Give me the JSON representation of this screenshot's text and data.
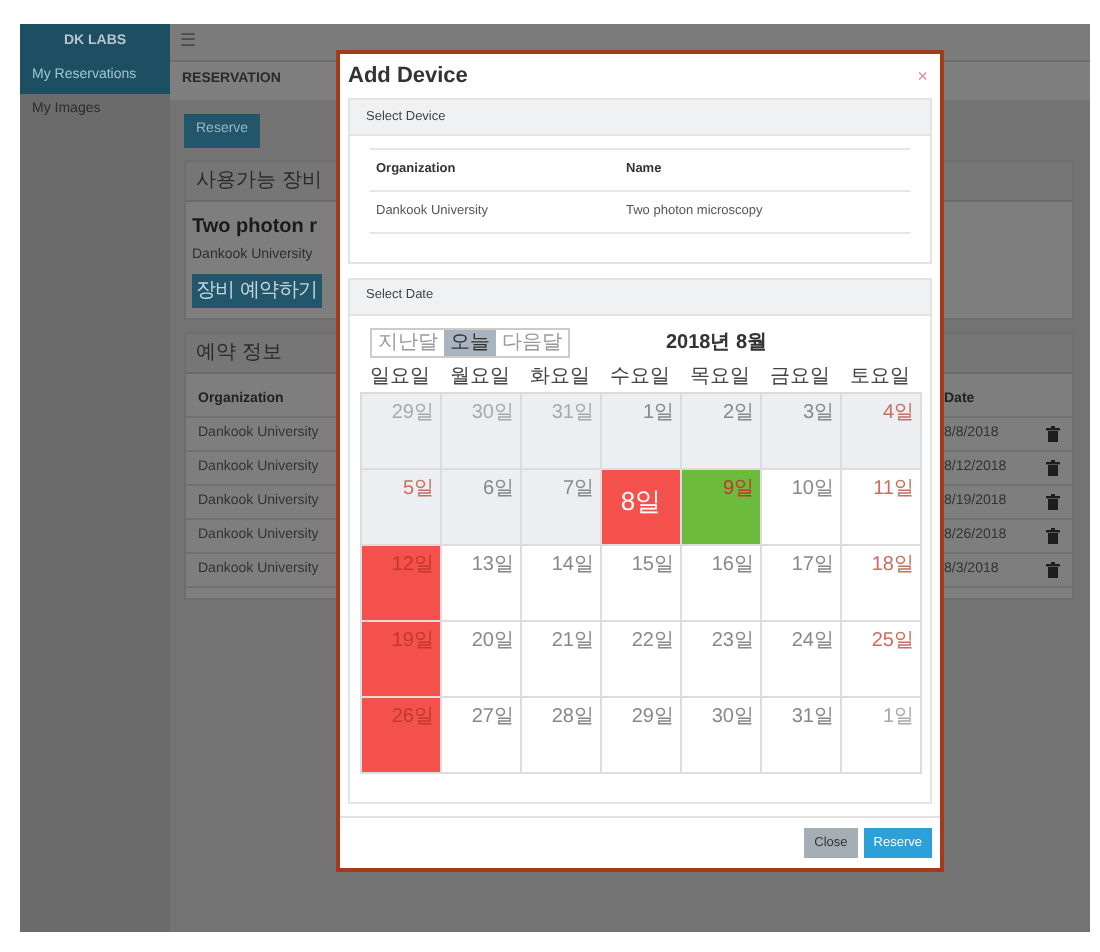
{
  "sidebar": {
    "brand": "DK LABS",
    "items": [
      {
        "label": "My Reservations",
        "selected": true
      },
      {
        "label": "My Images",
        "selected": false
      }
    ]
  },
  "topbar": {
    "menu": "☰",
    "breadcrumb": "RESERVATION"
  },
  "reserve_button": "Reserve",
  "available_card": {
    "title": "사용가능 장비",
    "device_name": "Two photon r",
    "organization": "Dankook University",
    "button": "장비 예약하기"
  },
  "reservations_card": {
    "title": "예약 정보",
    "columns": [
      "Organization",
      "Date"
    ],
    "rows": [
      {
        "organization": "Dankook University",
        "date": "8/8/2018"
      },
      {
        "organization": "Dankook University",
        "date": "8/12/2018"
      },
      {
        "organization": "Dankook University",
        "date": "8/19/2018"
      },
      {
        "organization": "Dankook University",
        "date": "8/26/2018"
      },
      {
        "organization": "Dankook University",
        "date": "8/3/2018"
      }
    ]
  },
  "modal": {
    "title": "Add Device",
    "close": "×",
    "device_section": {
      "title": "Select Device",
      "columns": [
        "Organization",
        "Name"
      ],
      "rows": [
        [
          "Dankook University",
          "Two photon microscopy"
        ]
      ]
    },
    "date_section": {
      "title": "Select Date",
      "nav": [
        {
          "label": "지난달",
          "selected": false
        },
        {
          "label": "오늘",
          "selected": true
        },
        {
          "label": "다음달",
          "selected": false
        }
      ],
      "month": "2018년 8월",
      "weekdays": [
        "일요일",
        "월요일",
        "화요일",
        "수요일",
        "목요일",
        "금요일",
        "토요일"
      ],
      "weeks": [
        [
          {
            "label": "29일",
            "past": true,
            "other_month": true
          },
          {
            "label": "30일",
            "past": true,
            "other_month": true
          },
          {
            "label": "31일",
            "past": true,
            "other_month": true
          },
          {
            "label": "1일",
            "past": true,
            "other_month": false
          },
          {
            "label": "2일",
            "past": true,
            "other_month": false
          },
          {
            "label": "3일",
            "past": true,
            "other_month": false
          },
          {
            "label": "4일",
            "past": true,
            "other_month": false
          }
        ],
        [
          {
            "label": "5일",
            "past": true,
            "other_month": false
          },
          {
            "label": "6일",
            "past": true,
            "other_month": false
          },
          {
            "label": "7일",
            "past": true,
            "other_month": false
          },
          {
            "label": "8일",
            "past": false,
            "other_month": false,
            "today": true,
            "color": "#f5514c"
          },
          {
            "label": "9일",
            "past": false,
            "other_month": false,
            "color": "#6cbb3c"
          },
          {
            "label": "10일",
            "past": false,
            "other_month": false
          },
          {
            "label": "11일",
            "past": false,
            "other_month": false
          }
        ],
        [
          {
            "label": "12일",
            "past": false,
            "other_month": false,
            "color": "#f5514c"
          },
          {
            "label": "13일",
            "past": false,
            "other_month": false
          },
          {
            "label": "14일",
            "past": false,
            "other_month": false
          },
          {
            "label": "15일",
            "past": false,
            "other_month": false
          },
          {
            "label": "16일",
            "past": false,
            "other_month": false
          },
          {
            "label": "17일",
            "past": false,
            "other_month": false
          },
          {
            "label": "18일",
            "past": false,
            "other_month": false
          }
        ],
        [
          {
            "label": "19일",
            "past": false,
            "other_month": false,
            "color": "#f5514c"
          },
          {
            "label": "20일",
            "past": false,
            "other_month": false
          },
          {
            "label": "21일",
            "past": false,
            "other_month": false
          },
          {
            "label": "22일",
            "past": false,
            "other_month": false
          },
          {
            "label": "23일",
            "past": false,
            "other_month": false
          },
          {
            "label": "24일",
            "past": false,
            "other_month": false
          },
          {
            "label": "25일",
            "past": false,
            "other_month": false
          }
        ],
        [
          {
            "label": "26일",
            "past": false,
            "other_month": false,
            "color": "#f5514c"
          },
          {
            "label": "27일",
            "past": false,
            "other_month": false
          },
          {
            "label": "28일",
            "past": false,
            "other_month": false
          },
          {
            "label": "29일",
            "past": false,
            "other_month": false
          },
          {
            "label": "30일",
            "past": false,
            "other_month": false
          },
          {
            "label": "31일",
            "past": false,
            "other_month": false
          },
          {
            "label": "1일",
            "past": false,
            "other_month": true
          }
        ]
      ]
    },
    "buttons": [
      {
        "label": "Close",
        "kind": "secondary"
      },
      {
        "label": "Reserve",
        "kind": "primary"
      }
    ]
  }
}
